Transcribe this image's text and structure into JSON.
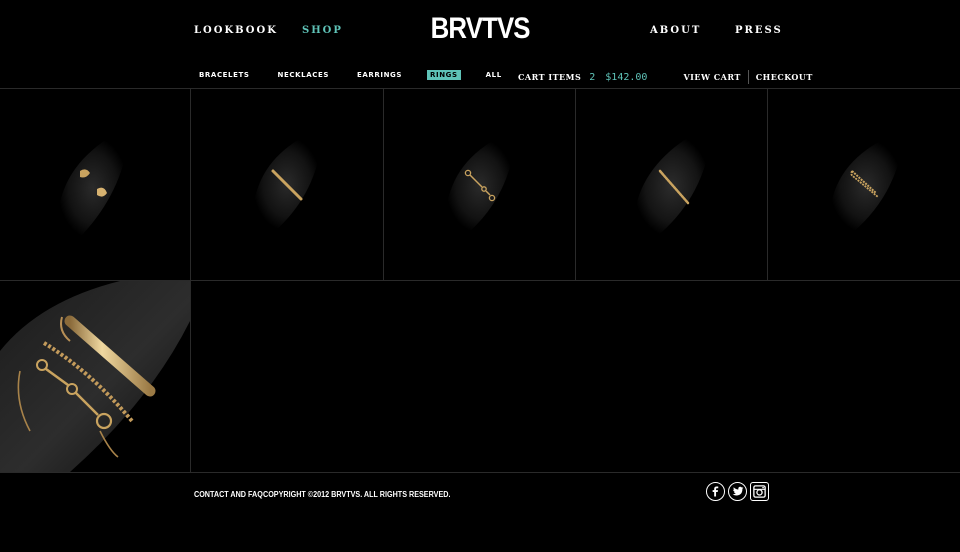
{
  "brand": "BRVTVS",
  "colors": {
    "background": "#000000",
    "accent": "#5fc3b8",
    "text": "#ffffff",
    "gold": "#c9a35f"
  },
  "main_nav": {
    "lookbook": "LOOKBOOK",
    "shop": "SHOP",
    "about": "ABOUT",
    "press": "PRESS",
    "active": "SHOP"
  },
  "categories": {
    "items": [
      "BRACELETS",
      "NECKLACES",
      "EARRINGS",
      "RINGS",
      "ALL"
    ],
    "active": "RINGS"
  },
  "cart": {
    "label": "CART ITEMS",
    "count": "2",
    "total": "$142.00",
    "view_cart": "VIEW CART",
    "checkout": "CHECKOUT"
  },
  "products": [
    {
      "icon": "open-cuff-ring-icon"
    },
    {
      "icon": "bar-ring-icon"
    },
    {
      "icon": "link-chain-ring-icon"
    },
    {
      "icon": "chain-ring-icon"
    },
    {
      "icon": "double-chain-ring-icon"
    },
    {
      "icon": "ring-stack-icon"
    }
  ],
  "footer": {
    "contact": "CONTACT AND FAQ",
    "copyright": "COPYRIGHT ©2012 BRVTVS. ALL RIGHTS RESERVED.",
    "social": [
      "facebook-icon",
      "twitter-icon",
      "instagram-icon"
    ]
  }
}
